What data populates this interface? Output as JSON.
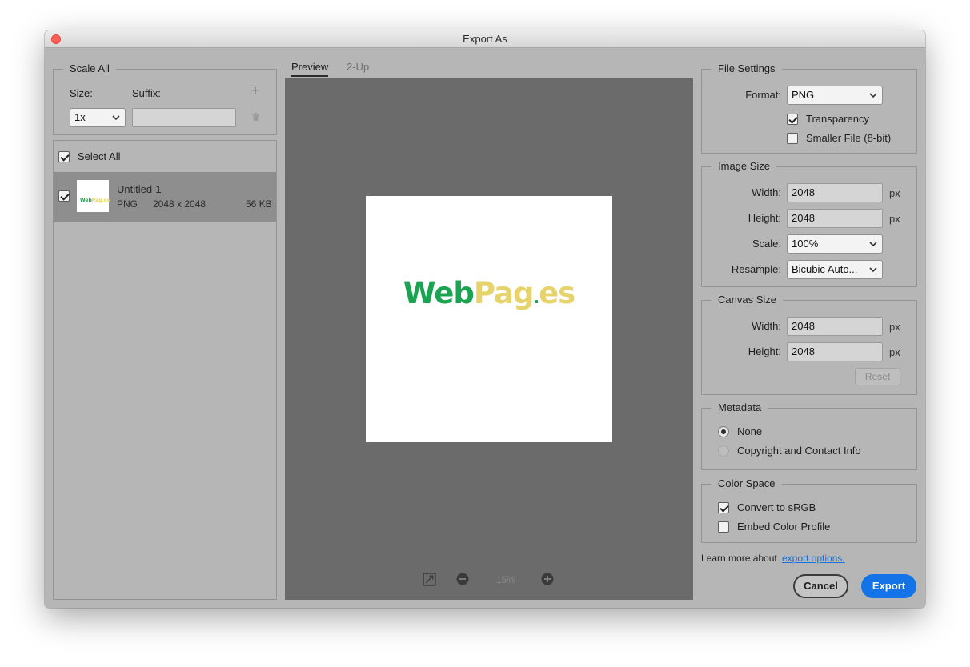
{
  "window": {
    "title": "Export As"
  },
  "scale_all": {
    "legend": "Scale All",
    "size_label": "Size:",
    "suffix_label": "Suffix:",
    "size_value": "1x",
    "suffix_value": "",
    "add_symbol": "+"
  },
  "asset_list": {
    "select_all_label": "Select All",
    "items": [
      {
        "name": "Untitled-1",
        "format": "PNG",
        "dimensions": "2048 x 2048",
        "size": "56 KB"
      }
    ]
  },
  "preview": {
    "tabs": [
      "Preview",
      "2-Up"
    ],
    "logo_part1": "Web",
    "logo_part2": "Pag",
    "logo_part3": ".es",
    "zoom": "15%"
  },
  "file_settings": {
    "legend": "File Settings",
    "format_label": "Format:",
    "format_value": "PNG",
    "transparency_label": "Transparency",
    "transparency_checked": true,
    "smaller_file_label": "Smaller File (8-bit)",
    "smaller_file_checked": false
  },
  "image_size": {
    "legend": "Image Size",
    "width_label": "Width:",
    "width_value": "2048",
    "height_label": "Height:",
    "height_value": "2048",
    "scale_label": "Scale:",
    "scale_value": "100%",
    "resample_label": "Resample:",
    "resample_value": "Bicubic Auto...",
    "unit": "px"
  },
  "canvas_size": {
    "legend": "Canvas Size",
    "width_label": "Width:",
    "width_value": "2048",
    "height_label": "Height:",
    "height_value": "2048",
    "unit": "px",
    "reset_label": "Reset"
  },
  "metadata": {
    "legend": "Metadata",
    "none_label": "None",
    "copyright_label": "Copyright and Contact Info"
  },
  "color_space": {
    "legend": "Color Space",
    "convert_label": "Convert to sRGB",
    "embed_label": "Embed Color Profile"
  },
  "footer": {
    "learn_text": "Learn more about",
    "learn_link": "export options.",
    "cancel_label": "Cancel",
    "export_label": "Export"
  },
  "colors": {
    "accent": "#1473e6",
    "logo_green": "#1aa350",
    "logo_yellow": "#e6d36b",
    "window_bg": "#b6b6b6",
    "preview_bg": "#6b6b6b"
  }
}
